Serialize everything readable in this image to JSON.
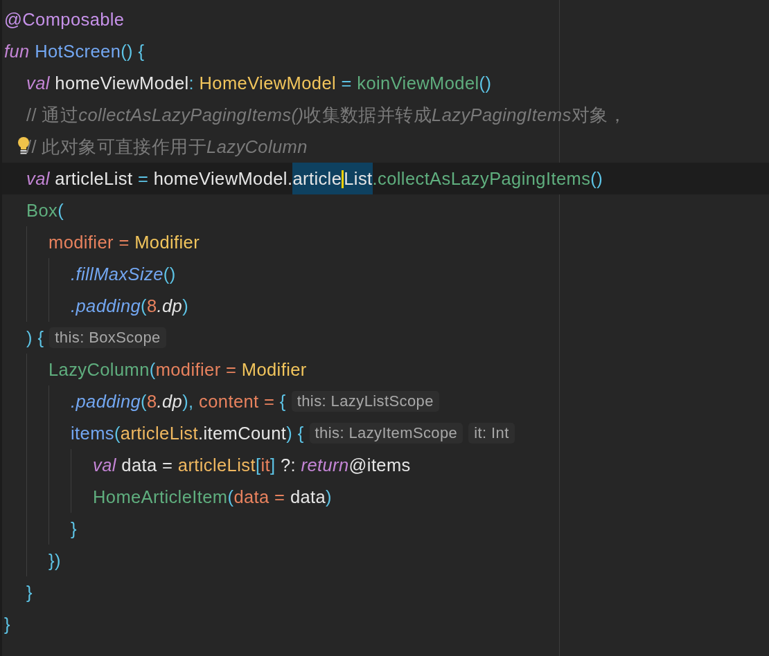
{
  "editor": {
    "lines": [
      {
        "current": false,
        "intention": false,
        "tokens": [
          {
            "kind": "annotation",
            "text": "@Composable"
          }
        ]
      },
      {
        "current": false,
        "intention": false,
        "tokens": [
          {
            "kind": "keyword",
            "text": "fun"
          },
          {
            "kind": "decl",
            "text": " HotScreen"
          },
          {
            "kind": "punct",
            "text": "() {"
          }
        ],
        "children": [
          {
            "current": false,
            "intention": false,
            "tokens": [
              {
                "kind": "keyword",
                "text": "val"
              },
              {
                "kind": "plain",
                "text": " homeViewModel"
              },
              {
                "kind": "punct",
                "text": ": "
              },
              {
                "kind": "type",
                "text": "HomeViewModel"
              },
              {
                "kind": "punct",
                "text": " = "
              },
              {
                "kind": "call",
                "text": "koinViewModel"
              },
              {
                "kind": "punct",
                "text": "()"
              }
            ]
          },
          {
            "current": false,
            "intention": false,
            "tokens": [
              {
                "kind": "comment",
                "parts": [
                  {
                    "italic": false,
                    "text": "// 通过"
                  },
                  {
                    "italic": true,
                    "text": "collectAsLazyPagingItems()"
                  },
                  {
                    "italic": false,
                    "text": "收集数据并转成"
                  },
                  {
                    "italic": true,
                    "text": "LazyPagingItems"
                  },
                  {
                    "italic": false,
                    "text": "对象，"
                  }
                ]
              }
            ]
          },
          {
            "current": false,
            "intention": true,
            "tokens": [
              {
                "kind": "comment",
                "parts": [
                  {
                    "italic": false,
                    "text": "// 此对象可直接作用于"
                  },
                  {
                    "italic": true,
                    "text": "LazyColumn"
                  }
                ]
              }
            ]
          },
          {
            "current": true,
            "intention": false,
            "tokens": [
              {
                "kind": "keyword",
                "text": "val"
              },
              {
                "kind": "plain",
                "text": " articleList "
              },
              {
                "kind": "punct",
                "text": "="
              },
              {
                "kind": "plain",
                "text": " homeViewModel."
              },
              {
                "kind": "selection",
                "before_caret": "article",
                "after_caret": "List"
              },
              {
                "kind": "call",
                "text": ".collectAsLazyPagingItems"
              },
              {
                "kind": "punct",
                "text": "()"
              }
            ]
          },
          {
            "current": false,
            "intention": false,
            "tokens": [
              {
                "kind": "call",
                "text": "Box"
              },
              {
                "kind": "punct",
                "text": "("
              }
            ],
            "children": [
              {
                "current": false,
                "intention": false,
                "tokens": [
                  {
                    "kind": "param",
                    "text": "modifier = "
                  },
                  {
                    "kind": "type",
                    "text": "Modifier"
                  }
                ],
                "children": [
                  {
                    "current": false,
                    "intention": false,
                    "tokens": [
                      {
                        "kind": "ext",
                        "text": ".fillMaxSize"
                      },
                      {
                        "kind": "punct",
                        "text": "()"
                      }
                    ]
                  },
                  {
                    "current": false,
                    "intention": false,
                    "tokens": [
                      {
                        "kind": "ext",
                        "text": ".padding"
                      },
                      {
                        "kind": "punct",
                        "text": "("
                      },
                      {
                        "kind": "number",
                        "text": "8"
                      },
                      {
                        "kind": "prop",
                        "text": ".dp"
                      },
                      {
                        "kind": "punct",
                        "text": ")"
                      }
                    ]
                  }
                ]
              }
            ]
          },
          {
            "current": false,
            "intention": false,
            "tokens": [
              {
                "kind": "punct",
                "text": ") {"
              },
              {
                "kind": "hint",
                "text": "this: BoxScope"
              }
            ],
            "children": [
              {
                "current": false,
                "intention": false,
                "tokens": [
                  {
                    "kind": "call",
                    "text": "LazyColumn"
                  },
                  {
                    "kind": "punct",
                    "text": "("
                  },
                  {
                    "kind": "param",
                    "text": "modifier = "
                  },
                  {
                    "kind": "type",
                    "text": "Modifier"
                  }
                ],
                "children": [
                  {
                    "current": false,
                    "intention": false,
                    "tokens": [
                      {
                        "kind": "ext",
                        "text": ".padding"
                      },
                      {
                        "kind": "punct",
                        "text": "("
                      },
                      {
                        "kind": "number",
                        "text": "8"
                      },
                      {
                        "kind": "prop",
                        "text": ".dp"
                      },
                      {
                        "kind": "punct",
                        "text": "), "
                      },
                      {
                        "kind": "param",
                        "text": "content = "
                      },
                      {
                        "kind": "punct",
                        "text": "{"
                      },
                      {
                        "kind": "hint",
                        "text": "this: LazyListScope"
                      }
                    ]
                  },
                  {
                    "current": false,
                    "intention": false,
                    "tokens": [
                      {
                        "kind": "func",
                        "text": "items"
                      },
                      {
                        "kind": "punct",
                        "text": "("
                      },
                      {
                        "kind": "var",
                        "text": "articleList"
                      },
                      {
                        "kind": "plain",
                        "text": ".itemCount"
                      },
                      {
                        "kind": "punct",
                        "text": ") {"
                      },
                      {
                        "kind": "hint",
                        "text": "this: LazyItemScope"
                      },
                      {
                        "kind": "hint",
                        "text": "it: Int"
                      }
                    ],
                    "children": [
                      {
                        "current": false,
                        "intention": false,
                        "tokens": [
                          {
                            "kind": "keyword",
                            "text": "val"
                          },
                          {
                            "kind": "plain",
                            "text": " data = "
                          },
                          {
                            "kind": "var",
                            "text": "articleList"
                          },
                          {
                            "kind": "punct",
                            "text": "["
                          },
                          {
                            "kind": "number",
                            "text": "it"
                          },
                          {
                            "kind": "punct",
                            "text": "]"
                          },
                          {
                            "kind": "plain",
                            "text": " ?: "
                          },
                          {
                            "kind": "keyword",
                            "text": "return"
                          },
                          {
                            "kind": "plain",
                            "text": "@items"
                          }
                        ]
                      },
                      {
                        "current": false,
                        "intention": false,
                        "tokens": [
                          {
                            "kind": "call",
                            "text": "HomeArticleItem"
                          },
                          {
                            "kind": "punct",
                            "text": "("
                          },
                          {
                            "kind": "param",
                            "text": "data = "
                          },
                          {
                            "kind": "plain",
                            "text": "data"
                          },
                          {
                            "kind": "punct",
                            "text": ")"
                          }
                        ]
                      }
                    ]
                  },
                  {
                    "current": false,
                    "intention": false,
                    "tokens": [
                      {
                        "kind": "punct",
                        "text": "}"
                      }
                    ]
                  }
                ]
              },
              {
                "current": false,
                "intention": false,
                "tokens": [
                  {
                    "kind": "punct",
                    "text": "})"
                  }
                ]
              }
            ]
          },
          {
            "current": false,
            "intention": false,
            "tokens": [
              {
                "kind": "punct",
                "text": "}"
              }
            ]
          }
        ]
      },
      {
        "current": false,
        "intention": false,
        "tokens": [
          {
            "kind": "punct",
            "text": "}"
          }
        ]
      }
    ]
  }
}
